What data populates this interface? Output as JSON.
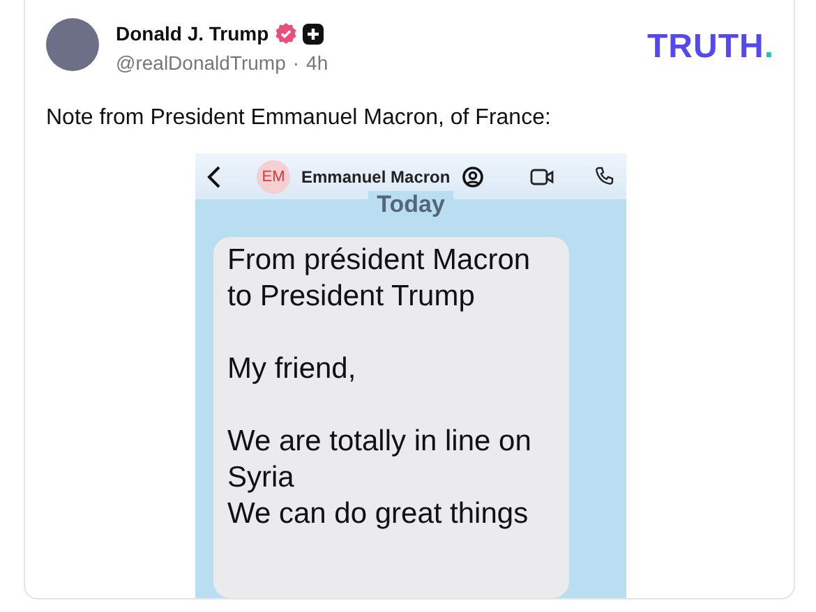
{
  "post": {
    "author": "Donald J. Trump",
    "handle": "@realDonaldTrump",
    "separator": "·",
    "time": "4h",
    "verified": true,
    "brand": {
      "word": "TRUTH",
      "dot": "."
    },
    "text": "Note from President Emmanuel Macron, of France:"
  },
  "screenshot": {
    "contact": {
      "initials": "EM",
      "name": "Emmanuel Macron"
    },
    "date_label": "Today",
    "message": [
      "From président Macron\nto President Trump",
      "My friend,",
      "We are totally in line on\nSyria\nWe can do great things"
    ]
  }
}
